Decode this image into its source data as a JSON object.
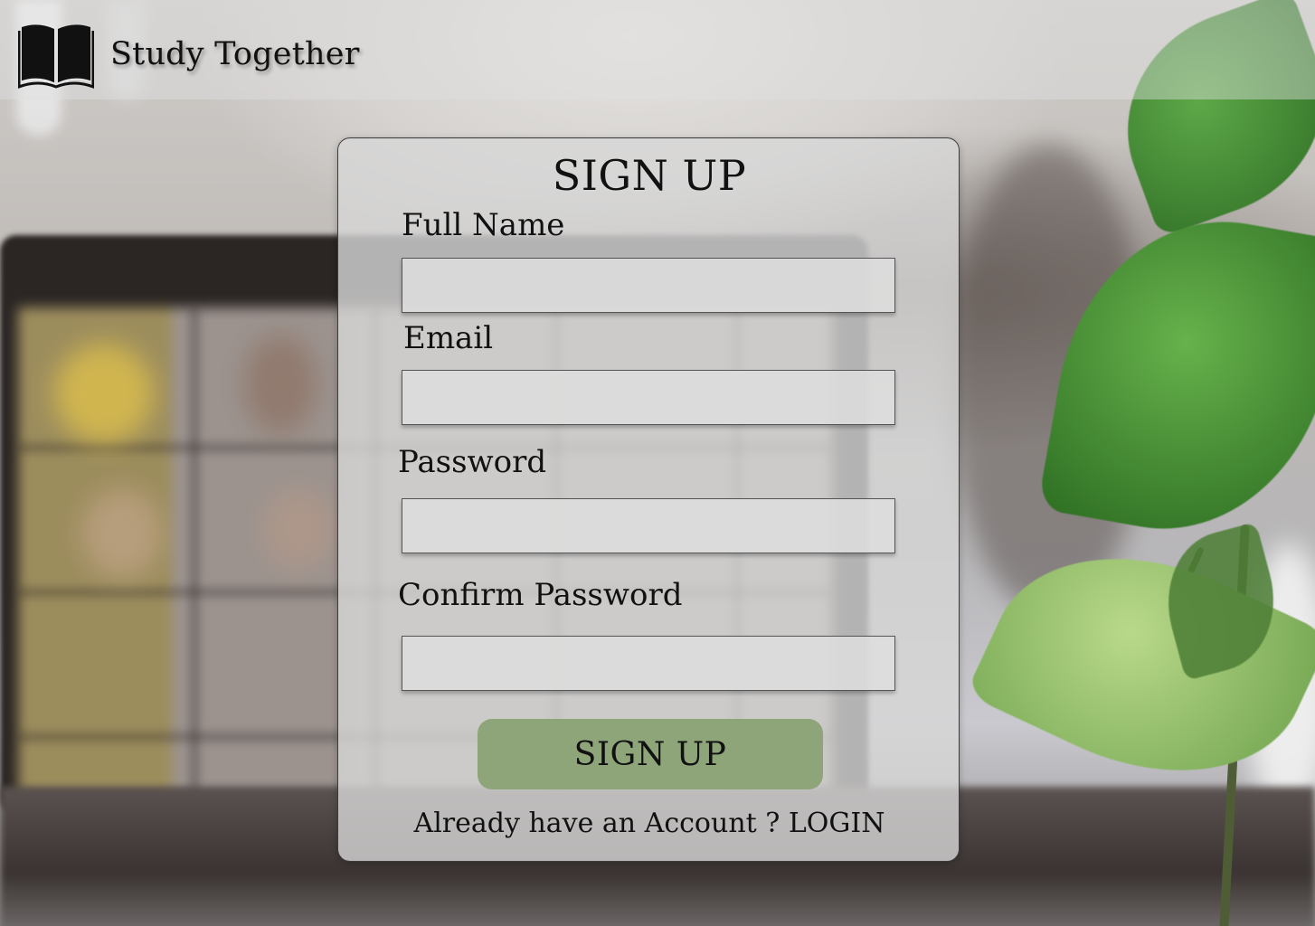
{
  "header": {
    "brand_title": "Study Together",
    "brand_icon": "open-book-icon"
  },
  "signup_form": {
    "title": "SIGN UP",
    "fields": [
      {
        "label": "Full Name",
        "value": "",
        "placeholder": ""
      },
      {
        "label": "Email",
        "value": "",
        "placeholder": ""
      },
      {
        "label": "Password",
        "value": "",
        "placeholder": ""
      },
      {
        "label": "Confirm Password",
        "value": "",
        "placeholder": ""
      }
    ],
    "submit_label": "SIGN UP",
    "login_prompt": "Already have an Account ? ",
    "login_link": "LOGIN"
  },
  "colors": {
    "button_bg": "#8ea579",
    "card_bg": "#d7d7d7",
    "text": "#111111"
  }
}
